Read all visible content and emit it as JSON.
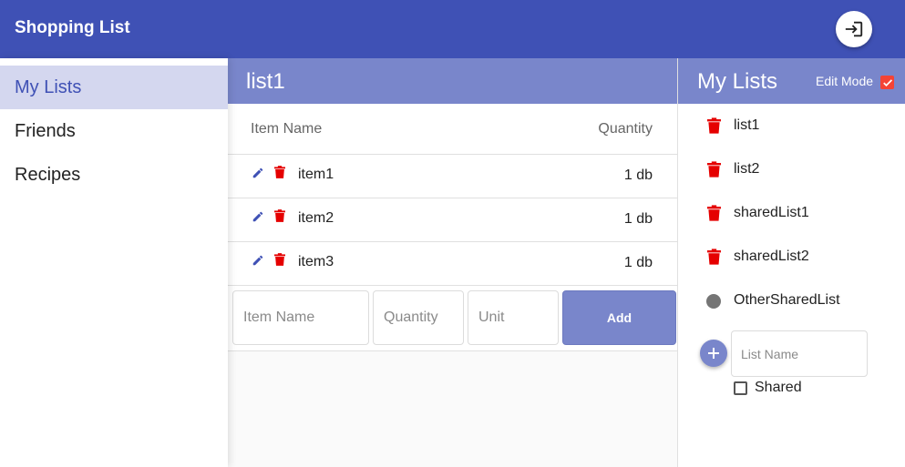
{
  "appbar": {
    "title": "Shopping List",
    "login_icon": "login-icon"
  },
  "sidenav": {
    "items": [
      {
        "label": "My Lists",
        "active": true
      },
      {
        "label": "Friends",
        "active": false
      },
      {
        "label": "Recipes",
        "active": false
      }
    ]
  },
  "list": {
    "title": "list1",
    "columns": {
      "name": "Item Name",
      "quantity": "Quantity"
    },
    "rows": [
      {
        "name": "item1",
        "quantity": "1 db"
      },
      {
        "name": "item2",
        "quantity": "1 db"
      },
      {
        "name": "item3",
        "quantity": "1 db"
      }
    ],
    "add_form": {
      "name_placeholder": "Item Name",
      "quantity_placeholder": "Quantity",
      "unit_placeholder": "Unit",
      "add_label": "Add"
    }
  },
  "my_lists": {
    "title": "My Lists",
    "edit_mode_label": "Edit Mode",
    "edit_mode_checked": true,
    "items": [
      {
        "label": "list1",
        "icon": "trash-icon"
      },
      {
        "label": "list2",
        "icon": "trash-icon"
      },
      {
        "label": "sharedList1",
        "icon": "trash-icon"
      },
      {
        "label": "sharedList2",
        "icon": "trash-icon"
      },
      {
        "label": "OtherSharedList",
        "icon": "circle-icon"
      }
    ],
    "new_list_placeholder": "List Name",
    "shared_label": "Shared",
    "shared_checked": false
  },
  "colors": {
    "primary": "#3f51b5",
    "primary_light": "#7986cb",
    "active_nav_bg": "#d4d7ef",
    "delete_red": "#e50000",
    "checkbox_red": "#f44336"
  }
}
